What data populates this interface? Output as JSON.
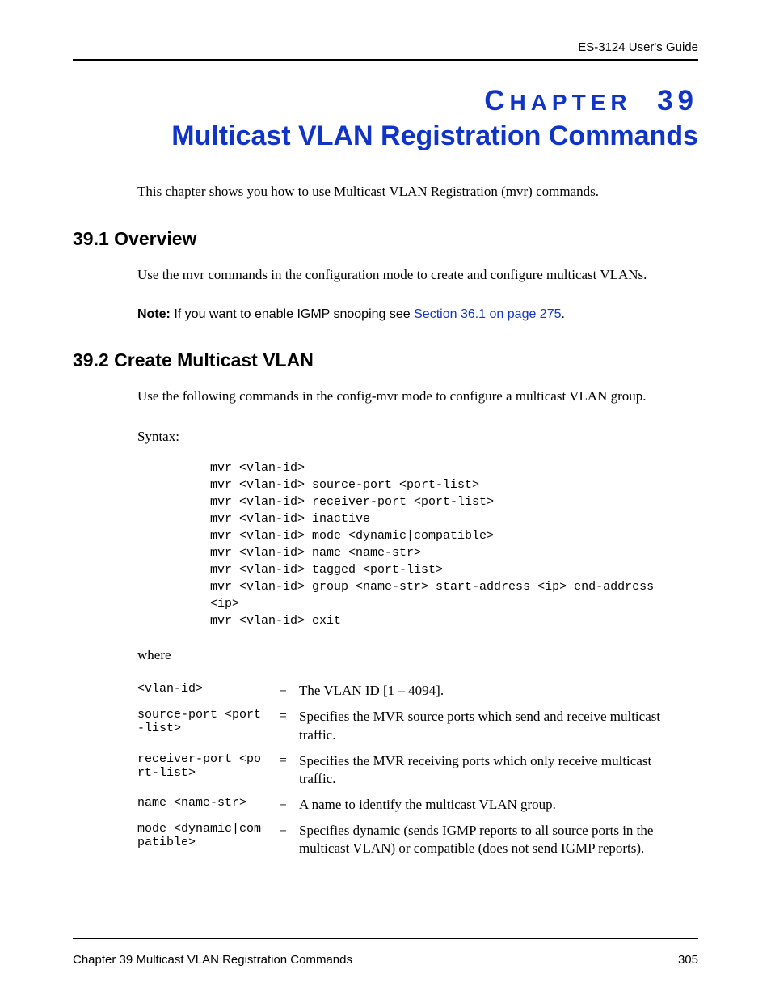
{
  "header": {
    "guide": "ES-3124 User's Guide"
  },
  "chapter": {
    "label_prefix": "C",
    "label_rest": "HAPTER",
    "number": "39",
    "title": "Multicast VLAN Registration Commands"
  },
  "intro": "This chapter shows you how to use Multicast VLAN Registration (mvr) commands.",
  "sections": {
    "overview": {
      "heading": "39.1  Overview",
      "body": "Use the mvr commands in the configuration mode to create and configure multicast VLANs.",
      "note_bold": "Note:",
      "note_text_before": " If you want to enable IGMP snooping see ",
      "note_link": "Section 36.1 on page 275",
      "note_text_after": "."
    },
    "create": {
      "heading": "39.2  Create Multicast VLAN",
      "body": "Use the following commands in the config-mvr mode to configure a multicast VLAN group.",
      "syntax_label": "Syntax:",
      "code": "mvr <vlan-id>\nmvr <vlan-id> source-port <port-list>\nmvr <vlan-id> receiver-port <port-list>\nmvr <vlan-id> inactive\nmvr <vlan-id> mode <dynamic|compatible>\nmvr <vlan-id> name <name-str>\nmvr <vlan-id> tagged <port-list>\nmvr <vlan-id> group <name-str> start-address <ip> end-address\n<ip>\nmvr <vlan-id> exit",
      "where_label": "where",
      "params": [
        {
          "param": "<vlan-id>",
          "desc": "The VLAN ID [1 – 4094]."
        },
        {
          "param": "source-port <port-list>",
          "desc": "Specifies the MVR source ports which send and receive multicast traffic."
        },
        {
          "param": "receiver-port <port-list>",
          "desc": "Specifies the MVR receiving ports which only receive multicast traffic."
        },
        {
          "param": "name <name-str>",
          "desc": "A name to identify the multicast VLAN group."
        },
        {
          "param": "mode <dynamic|compatible>",
          "desc": "Specifies dynamic (sends IGMP reports to all source ports in the multicast VLAN) or compatible (does not send IGMP reports)."
        }
      ]
    }
  },
  "footer": {
    "left": "Chapter 39 Multicast VLAN Registration Commands",
    "right": "305"
  }
}
